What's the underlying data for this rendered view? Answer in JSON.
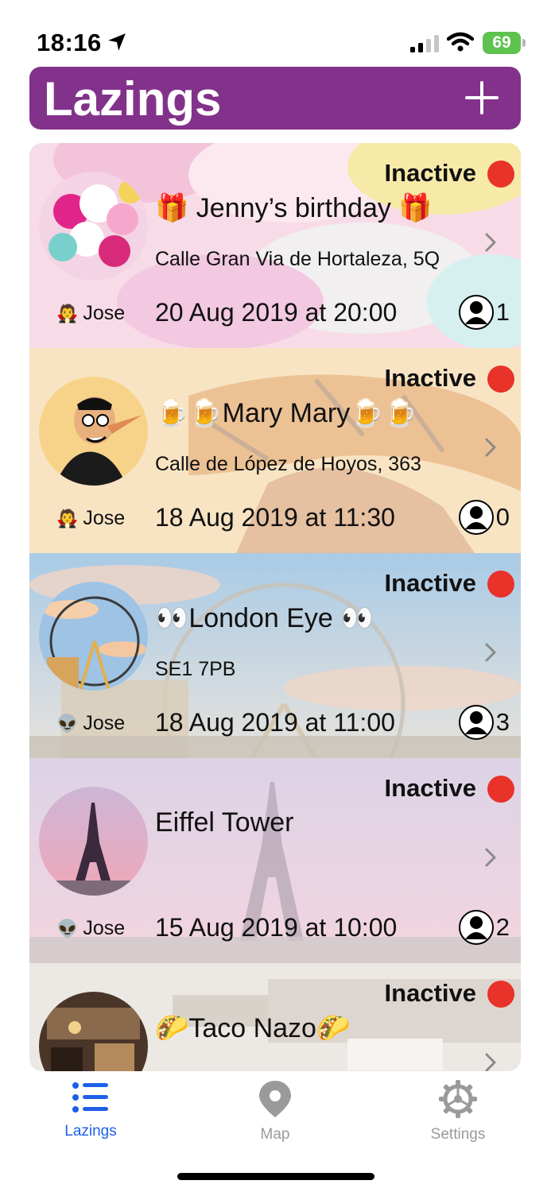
{
  "status_bar": {
    "time": "18:16",
    "battery": "69"
  },
  "header": {
    "title": "Lazings"
  },
  "events": [
    {
      "status": "Inactive",
      "title": "🎁 Jenny’s birthday 🎁",
      "address": "Calle Gran Via de Hortaleza, 5Q",
      "owner_emoji": "🧛",
      "owner": "Jose",
      "date": "20 Aug 2019 at 20:00",
      "attendees": "1"
    },
    {
      "status": "Inactive",
      "title": "🍺🍺Mary Mary🍺🍺",
      "address": "Calle de López de Hoyos, 363",
      "owner_emoji": "🧛",
      "owner": "Jose",
      "date": "18 Aug 2019 at 11:30",
      "attendees": "0"
    },
    {
      "status": "Inactive",
      "title": "👀London Eye 👀",
      "address": "SE1 7PB",
      "owner_emoji": "👽",
      "owner": "Jose",
      "date": "18 Aug 2019 at 11:00",
      "attendees": "3"
    },
    {
      "status": "Inactive",
      "title": "Eiffel Tower",
      "address": "",
      "owner_emoji": "👽",
      "owner": "Jose",
      "date": "15 Aug 2019 at 10:00",
      "attendees": "2"
    },
    {
      "status": "Inactive",
      "title": "🌮Taco Nazo🌮",
      "address": "",
      "owner_emoji": "",
      "owner": "",
      "date": "",
      "attendees": ""
    }
  ],
  "tabs": [
    {
      "label": "Lazings",
      "icon": "list-icon",
      "active": true
    },
    {
      "label": "Map",
      "icon": "map-pin-icon",
      "active": false
    },
    {
      "label": "Settings",
      "icon": "gear-icon",
      "active": false
    }
  ],
  "colors": {
    "header": "#83328b",
    "status_inactive": "#e8322a",
    "tab_active": "#1e5fe8"
  }
}
